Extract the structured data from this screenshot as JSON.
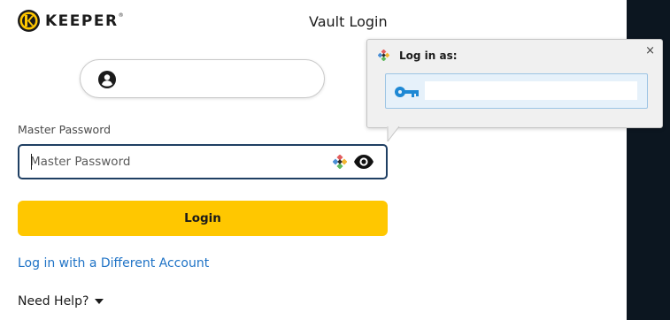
{
  "brand": {
    "name": "KEEPER",
    "trademark": "®"
  },
  "page_title": "Vault Login",
  "account_field": {
    "icon": "account-circle-icon",
    "value": ""
  },
  "password": {
    "label": "Master Password",
    "placeholder": "Master Password",
    "value": "",
    "fill_icon": "keeper-fill-icon",
    "visibility_icon": "eye-icon"
  },
  "login_button": {
    "label": "Login",
    "color": "#ffc700"
  },
  "different_account_link": "Log in with a Different Account",
  "need_help": {
    "label": "Need Help?",
    "icon": "caret-down-icon"
  },
  "popup": {
    "title": "Log in as:",
    "close_label": "×",
    "entry": {
      "icon": "key-icon",
      "value": ""
    }
  },
  "colors": {
    "accent_yellow": "#ffc700",
    "link_blue": "#1f73c6",
    "field_border": "#1f3f63",
    "dark_panel": "#0c1620"
  }
}
